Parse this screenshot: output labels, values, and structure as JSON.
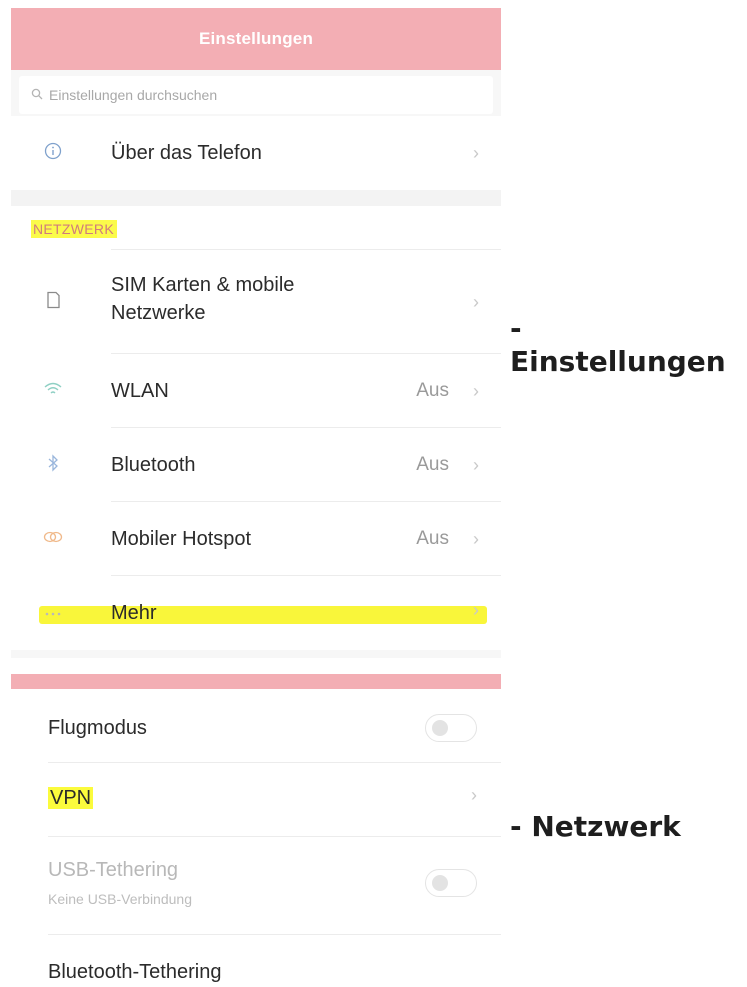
{
  "settings": {
    "title": "Einstellungen",
    "search_placeholder": "Einstellungen durchsuchen",
    "about_label": "Über das Telefon",
    "section_title": "NETZWERK",
    "items": [
      {
        "label_line1": "SIM Karten & mobile",
        "label_line2": "Netzwerke",
        "value": "",
        "icon": "sim-card-icon"
      },
      {
        "label": "WLAN",
        "value": "Aus",
        "icon": "wifi-icon"
      },
      {
        "label": "Bluetooth",
        "value": "Aus",
        "icon": "bluetooth-icon"
      },
      {
        "label": "Mobiler Hotspot",
        "value": "Aus",
        "icon": "hotspot-icon"
      },
      {
        "label": "Mehr",
        "value": "",
        "icon": "more-icon"
      }
    ]
  },
  "network": {
    "items": [
      {
        "label": "Flugmodus",
        "toggle": false
      },
      {
        "label": "VPN"
      },
      {
        "label": "USB-Tethering",
        "sub": "Keine USB-Verbindung",
        "toggle": false
      },
      {
        "label": "Bluetooth-Tethering"
      }
    ]
  },
  "captions": {
    "einstellungen": "- Einstellungen",
    "netzwerk": "- Netzwerk"
  },
  "colors": {
    "header_pink": "#f3aeb4",
    "highlight_yellow": "#fbfb3c"
  }
}
